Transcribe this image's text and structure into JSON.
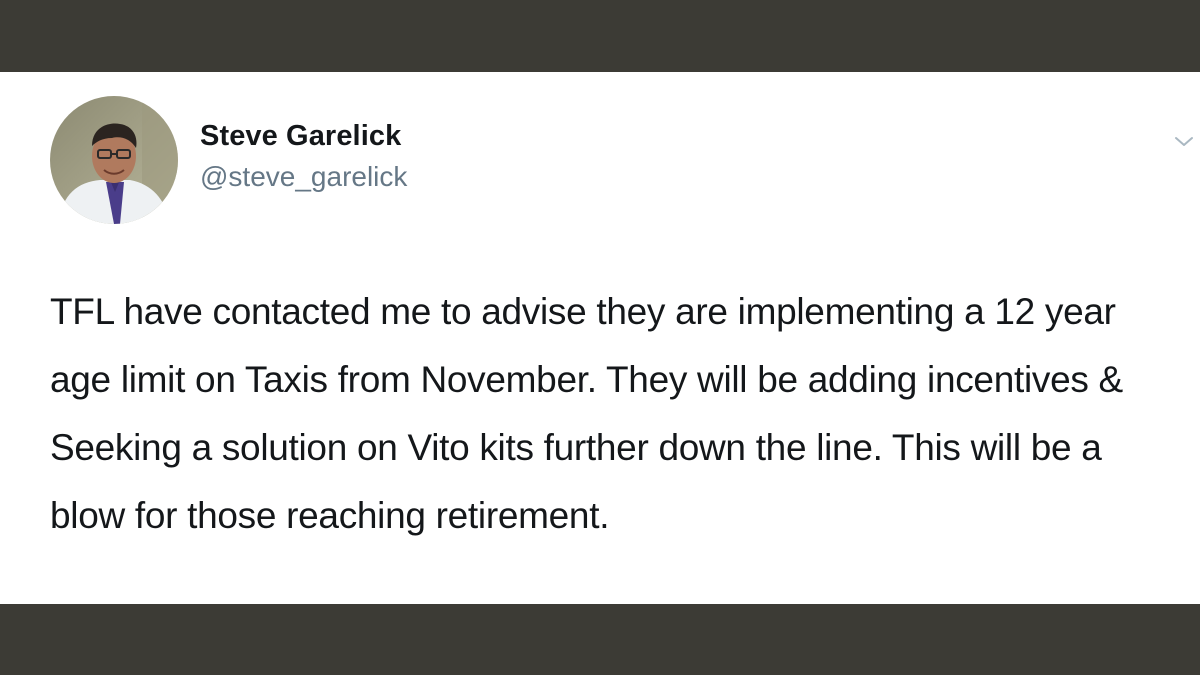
{
  "tweet": {
    "author": {
      "display_name": "Steve Garelick",
      "handle": "@steve_garelick",
      "avatar_icon": "profile-photo"
    },
    "text": "TFL have contacted me to advise they are implementing a 12 year age limit on Taxis from November. They will be adding incentives & Seeking a solution on Vito kits further down the line. This will be a blow for those reaching retirement.",
    "menu_icon": "chevron-down-icon"
  },
  "colors": {
    "frame": "#3c3b35",
    "card": "#ffffff",
    "text": "#14171a",
    "secondary": "#657786"
  }
}
